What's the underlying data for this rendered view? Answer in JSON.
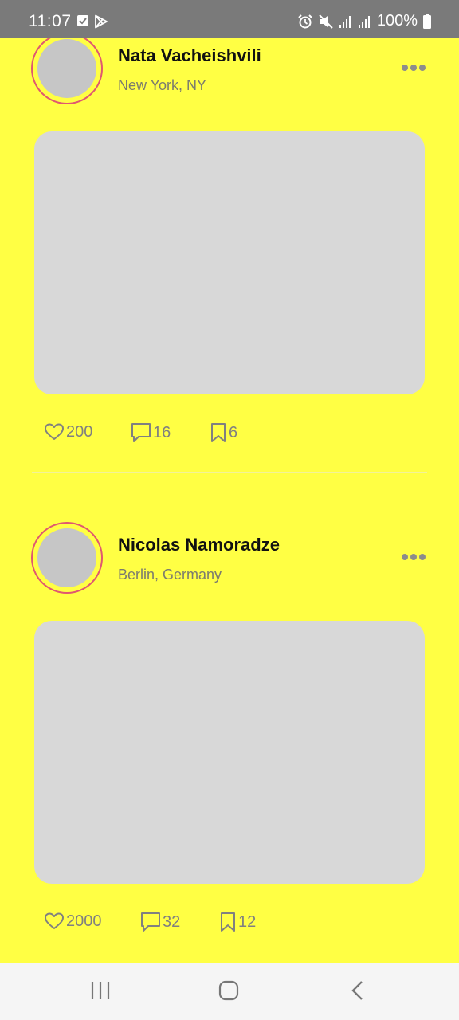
{
  "status_bar": {
    "time": "11:07",
    "battery": "100%",
    "icons": [
      "checkbox-icon",
      "play-store-icon",
      "alarm-icon",
      "mute-icon",
      "signal-icon",
      "signal-icon",
      "battery-icon"
    ]
  },
  "posts": [
    {
      "name": "Nata Vacheishvili",
      "location": "New York, NY",
      "likes": "200",
      "comments": "16",
      "saves": "6"
    },
    {
      "name": "Nicolas Namoradze",
      "location": "Berlin, Germany",
      "likes": "2000",
      "comments": "32",
      "saves": "12"
    }
  ],
  "colors": {
    "background": "#FFFF44",
    "status_bar": "#7a7a7a",
    "image_placeholder": "#d8d8d8",
    "avatar_ring": "#e05870",
    "nav_bar": "#f5f5f5"
  },
  "nav": {
    "icons": [
      "recent-apps-icon",
      "home-icon",
      "back-icon"
    ]
  }
}
